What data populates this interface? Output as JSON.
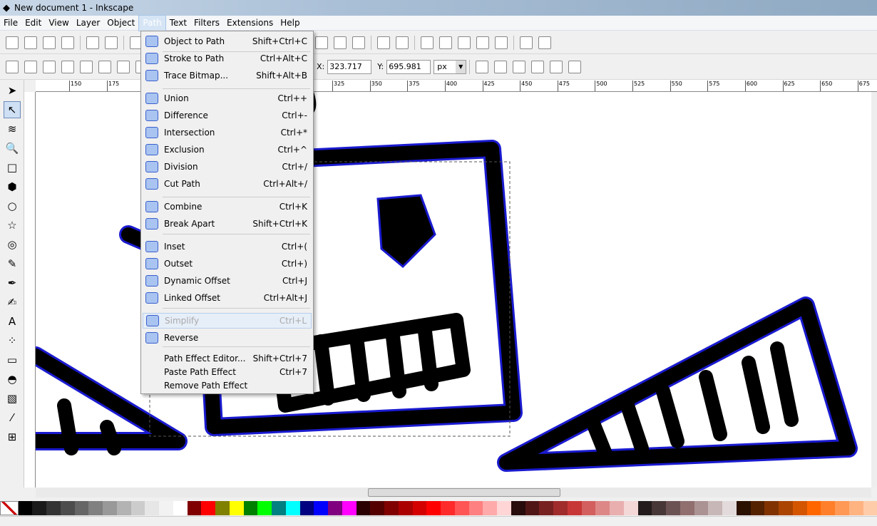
{
  "window": {
    "title": "New document 1 - Inkscape"
  },
  "menubar": [
    "File",
    "Edit",
    "View",
    "Layer",
    "Object",
    "Path",
    "Text",
    "Filters",
    "Extensions",
    "Help"
  ],
  "active_menu": "Path",
  "toolbar2": {
    "x_label": "X:",
    "x_value": "323.717",
    "y_label": "Y:",
    "y_value": "695.981",
    "unit": "px"
  },
  "ruler": [
    "150",
    "175",
    "325",
    "350",
    "375",
    "400",
    "425",
    "450",
    "475",
    "500",
    "525",
    "550",
    "575",
    "600",
    "625",
    "650",
    "675"
  ],
  "path_menu": [
    {
      "label": "Object to Path",
      "shortcut": "Shift+Ctrl+C",
      "icon": "object-to-path-icon"
    },
    {
      "label": "Stroke to Path",
      "shortcut": "Ctrl+Alt+C",
      "icon": "stroke-to-path-icon"
    },
    {
      "label": "Trace Bitmap...",
      "shortcut": "Shift+Alt+B",
      "icon": "trace-bitmap-icon"
    },
    {
      "label": "Union",
      "shortcut": "Ctrl++",
      "icon": "union-icon"
    },
    {
      "label": "Difference",
      "shortcut": "Ctrl+-",
      "icon": "difference-icon"
    },
    {
      "label": "Intersection",
      "shortcut": "Ctrl+*",
      "icon": "intersection-icon"
    },
    {
      "label": "Exclusion",
      "shortcut": "Ctrl+^",
      "icon": "exclusion-icon"
    },
    {
      "label": "Division",
      "shortcut": "Ctrl+/",
      "icon": "division-icon"
    },
    {
      "label": "Cut Path",
      "shortcut": "Ctrl+Alt+/",
      "icon": "cut-path-icon"
    },
    {
      "label": "Combine",
      "shortcut": "Ctrl+K",
      "icon": "combine-icon"
    },
    {
      "label": "Break Apart",
      "shortcut": "Shift+Ctrl+K",
      "icon": "break-apart-icon"
    },
    {
      "label": "Inset",
      "shortcut": "Ctrl+(",
      "icon": "inset-icon"
    },
    {
      "label": "Outset",
      "shortcut": "Ctrl+)",
      "icon": "outset-icon"
    },
    {
      "label": "Dynamic Offset",
      "shortcut": "Ctrl+J",
      "icon": "dynamic-offset-icon"
    },
    {
      "label": "Linked Offset",
      "shortcut": "Ctrl+Alt+J",
      "icon": "linked-offset-icon"
    },
    {
      "label": "Simplify",
      "shortcut": "Ctrl+L",
      "icon": "simplify-icon",
      "disabled": true
    },
    {
      "label": "Reverse",
      "shortcut": "",
      "icon": "reverse-icon"
    },
    {
      "label": "Path Effect Editor...",
      "shortcut": "Shift+Ctrl+7"
    },
    {
      "label": "Paste Path Effect",
      "shortcut": "Ctrl+7"
    },
    {
      "label": "Remove Path Effect",
      "shortcut": ""
    }
  ],
  "palette": [
    "#000000",
    "#1a1a1a",
    "#333333",
    "#4d4d4d",
    "#666666",
    "#808080",
    "#999999",
    "#b3b3b3",
    "#cccccc",
    "#e6e6e6",
    "#f2f2f2",
    "#ffffff",
    "#800000",
    "#ff0000",
    "#808000",
    "#ffff00",
    "#008000",
    "#00ff00",
    "#008080",
    "#00ffff",
    "#000080",
    "#0000ff",
    "#800080",
    "#ff00ff",
    "#2b0000",
    "#550000",
    "#800000",
    "#aa0000",
    "#d40000",
    "#ff0000",
    "#ff2a2a",
    "#ff5555",
    "#ff8080",
    "#ffaaaa",
    "#ffd5d5",
    "#280b0b",
    "#501616",
    "#782121",
    "#a02c2c",
    "#c83737",
    "#d35f5f",
    "#de8787",
    "#e9afaf",
    "#f4d7d7",
    "#241c1c",
    "#483737",
    "#6c5353",
    "#916f6f",
    "#ac9393",
    "#c8b7b7",
    "#e3dbdb",
    "#2b1100",
    "#552200",
    "#803300",
    "#aa4400",
    "#d45500",
    "#ff6600",
    "#ff7f2a",
    "#ff9955",
    "#ffb380",
    "#ffccaa"
  ]
}
